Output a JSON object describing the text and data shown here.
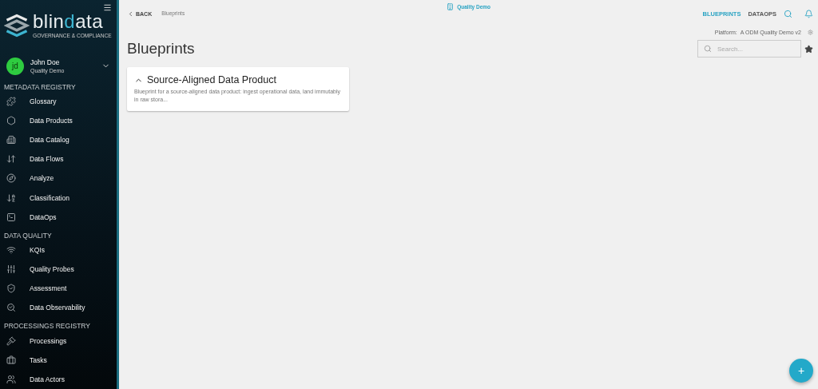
{
  "sidebar": {
    "logo": {
      "parts": [
        {
          "text": "blin",
          "accent": false
        },
        {
          "text": "d",
          "accent": true
        },
        {
          "text": "ata",
          "accent": false
        }
      ],
      "tagline": "GOVERNANCE & COMPLIANCE"
    },
    "user": {
      "initials": "jd",
      "name": "John Doe",
      "tenant": "Quality Demo"
    },
    "sections": [
      {
        "title": "METADATA REGISTRY",
        "items": [
          {
            "label": "Glossary"
          },
          {
            "label": "Data Products"
          },
          {
            "label": "Data Catalog"
          },
          {
            "label": "Data Flows"
          },
          {
            "label": "Analyze"
          },
          {
            "label": "Classification"
          },
          {
            "label": "DataOps"
          }
        ]
      },
      {
        "title": "DATA QUALITY",
        "items": [
          {
            "label": "KQIs"
          },
          {
            "label": "Quality Probes"
          },
          {
            "label": "Assessment"
          },
          {
            "label": "Data Observability"
          }
        ]
      },
      {
        "title": "PROCESSINGS REGISTRY",
        "items": [
          {
            "label": "Processings"
          },
          {
            "label": "Tasks"
          },
          {
            "label": "Data Actors"
          }
        ]
      }
    ]
  },
  "topbar": {
    "back": "BACK",
    "breadcrumb": "Blueprints",
    "tenant": "Quality Demo",
    "links": [
      {
        "label": "BLUEPRINTS",
        "selected": true
      },
      {
        "label": "DATAOPS",
        "selected": false
      }
    ],
    "platform_label": "Platform:",
    "platform": "A ODM Quality Demo v2"
  },
  "page": {
    "title": "Blueprints",
    "search": {
      "placeholder": "Search..."
    },
    "cards": [
      {
        "title": "Source-Aligned Data Product",
        "description": "Blueprint for a source-aligned data product: ingest operational data, land immutably in raw stora..."
      }
    ],
    "fab": "+"
  }
}
